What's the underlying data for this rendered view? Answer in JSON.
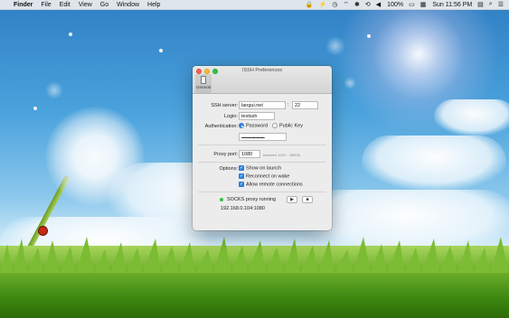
{
  "menubar": {
    "app": "Finder",
    "items": [
      "File",
      "Edit",
      "View",
      "Go",
      "Window",
      "Help"
    ],
    "battery": "100%",
    "clock": "Sun 11:56 PM"
  },
  "window": {
    "title": "ISSH Preferences",
    "tab_general": "General",
    "ssh_server_label": "SSH server:",
    "ssh_server_value": "langui.net",
    "port_sep": ":",
    "port_value": "22",
    "login_label": "Login:",
    "login_value": "testssh",
    "auth_label": "Authentication:",
    "auth_password": "Password",
    "auth_pubkey": "Public Key",
    "password_value": "••••••••••••••••••••",
    "proxy_label": "Proxy port:",
    "proxy_value": "1080",
    "proxy_hint": "between 1024 ~ 65535",
    "options_label": "Options:",
    "opt_launch": "Show on launch",
    "opt_wake": "Reconnect on wake",
    "opt_remote": "Allow remote connections",
    "status_text": "SOCKS proxy running",
    "address": "192.168.0.104:1080",
    "play_glyph": "▶",
    "stop_glyph": "■"
  },
  "colors": {
    "accent": "#2f86e6",
    "running": "#34c23f"
  }
}
